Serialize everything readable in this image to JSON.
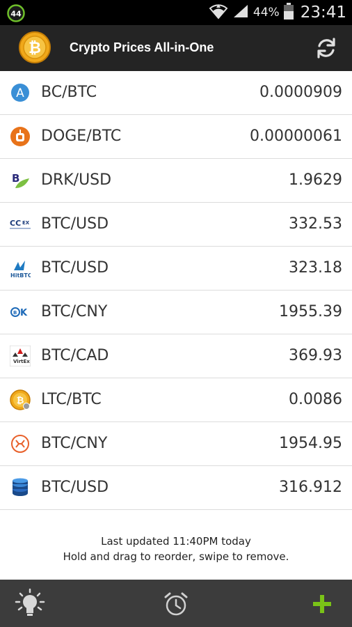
{
  "status_bar": {
    "notification_count": "44",
    "battery_percent": "44%",
    "time": "23:41"
  },
  "action_bar": {
    "title": "Crypto Prices All-in-One",
    "logo_icon": "bitcoin-logo-icon",
    "refresh_icon": "refresh-icon"
  },
  "prices": [
    {
      "pair": "BC/BTC",
      "price": "0.0000909",
      "icon": "exchange-a-icon"
    },
    {
      "pair": "DOGE/BTC",
      "price": "0.00000061",
      "icon": "exchange-orange-a-icon"
    },
    {
      "pair": "DRK/USD",
      "price": "1.9629",
      "icon": "exchange-b-leaf-icon"
    },
    {
      "pair": "BTC/USD",
      "price": "332.53",
      "icon": "ccex-icon"
    },
    {
      "pair": "BTC/USD",
      "price": "323.18",
      "icon": "hitbtc-icon"
    },
    {
      "pair": "BTC/CNY",
      "price": "1955.39",
      "icon": "okcoin-icon"
    },
    {
      "pair": "BTC/CAD",
      "price": "369.93",
      "icon": "virtex-icon"
    },
    {
      "pair": "LTC/BTC",
      "price": "0.0086",
      "icon": "litecoin-icon"
    },
    {
      "pair": "BTC/CNY",
      "price": "1954.95",
      "icon": "huobi-icon"
    },
    {
      "pair": "BTC/USD",
      "price": "316.912",
      "icon": "coin-stack-icon"
    }
  ],
  "footer": {
    "last_updated": "Last updated 11:40PM today",
    "hint": "Hold and drag to reorder, swipe to remove."
  },
  "bottom_bar": {
    "tip_icon": "lightbulb-icon",
    "alarm_icon": "alarm-clock-icon",
    "add_icon": "plus-icon"
  },
  "colors": {
    "action_bar": "#242424",
    "bottom_bar": "#3c3c3c",
    "add_green": "#7ac317",
    "bitcoin_orange": "#f7931a"
  }
}
